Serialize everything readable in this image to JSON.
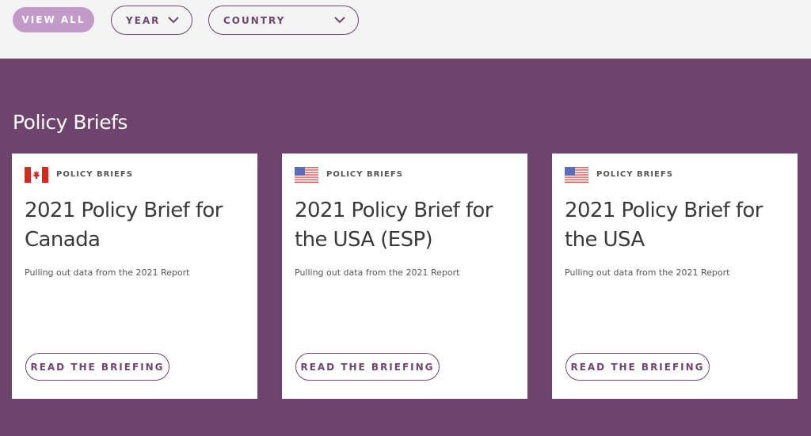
{
  "filters": {
    "view_all_label": "VIEW ALL",
    "year_label": "YEAR",
    "country_label": "COUNTRY"
  },
  "section": {
    "title": "Policy Briefs"
  },
  "cards": [
    {
      "flag": "canada-flag-icon",
      "category": "POLICY BRIEFS",
      "title": "2021 Policy Brief for Canada",
      "description": "Pulling out data from the 2021 Report",
      "button_label": "READ THE BRIEFING"
    },
    {
      "flag": "usa-flag-icon",
      "category": "POLICY BRIEFS",
      "title": "2021 Policy Brief for the USA (ESP)",
      "description": "Pulling out data from the 2021 Report",
      "button_label": "READ THE BRIEFING"
    },
    {
      "flag": "usa-flag-icon",
      "category": "POLICY BRIEFS",
      "title": "2021 Policy Brief for the USA",
      "description": "Pulling out data from the 2021 Report",
      "button_label": "READ THE BRIEFING"
    }
  ],
  "colors": {
    "accent": "#6e446f",
    "accent_light": "#c39bcb",
    "background": "#f4f4f4"
  }
}
